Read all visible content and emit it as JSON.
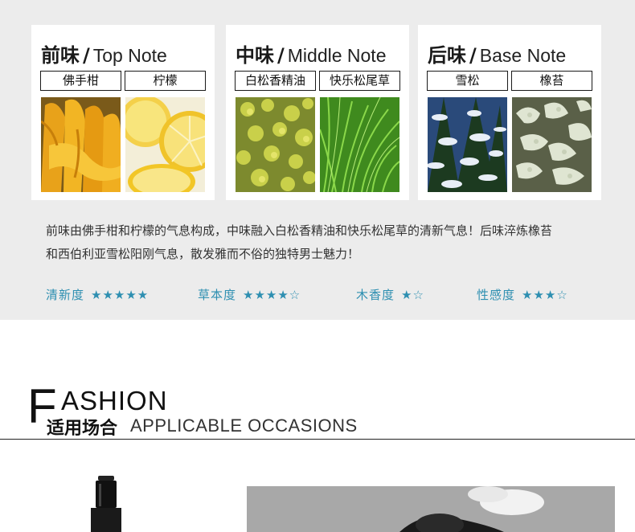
{
  "notes": [
    {
      "cn": "前味",
      "en": "Top Note",
      "ingredients": [
        {
          "label": "佛手柑",
          "icon": "bergamot-image"
        },
        {
          "label": "柠檬",
          "icon": "lemon-image"
        }
      ]
    },
    {
      "cn": "中味",
      "en": "Middle Note",
      "ingredients": [
        {
          "label": "白松香精油",
          "icon": "galbanum-image"
        },
        {
          "label": "快乐松尾草",
          "icon": "clary-sage-image"
        }
      ]
    },
    {
      "cn": "后味",
      "en": "Base Note",
      "ingredients": [
        {
          "label": "雪松",
          "icon": "cedar-image"
        },
        {
          "label": "橡苔",
          "icon": "oakmoss-image"
        }
      ]
    }
  ],
  "separator": "/",
  "description": {
    "line1": "前味由佛手柑和柠檬的气息构成，中味融入白松香精油和快乐松尾草的清新气息！后味淬炼橡苔",
    "line2": "和西伯利亚雪松阳刚气息，散发雅而不俗的独特男士魅力！"
  },
  "ratings": [
    {
      "label": "清新度",
      "stars": "★★★★★",
      "value": 5
    },
    {
      "label": "草本度",
      "stars": "★★★★☆",
      "value": 4
    },
    {
      "label": "木香度",
      "stars": "★☆",
      "value": 1
    },
    {
      "label": "性感度",
      "stars": "★★★☆",
      "value": 3
    }
  ],
  "section": {
    "heading_first_letter": "F",
    "heading_rest": "ASHION",
    "subtitle_cn": "适用场合",
    "subtitle_en": "APPLICABLE OCCASIONS"
  },
  "colors": {
    "background_top": "#ececec",
    "accent": "#2e8fb1",
    "text": "#333333"
  }
}
